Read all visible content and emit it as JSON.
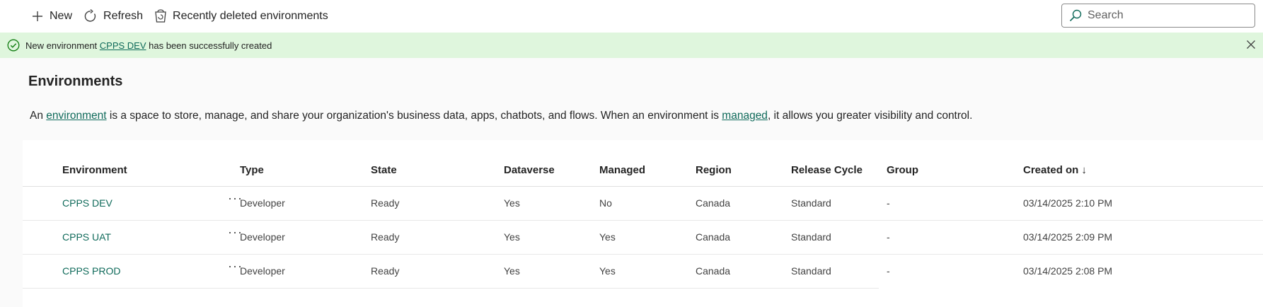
{
  "commandbar": {
    "new_label": "New",
    "refresh_label": "Refresh",
    "recently_deleted_label": "Recently deleted environments",
    "search_placeholder": "Search"
  },
  "banner": {
    "prefix": "New environment ",
    "env_link": "CPPS DEV",
    "suffix": " has been successfully created"
  },
  "page": {
    "title": "Environments",
    "desc_part1": "An ",
    "desc_link1": "environment",
    "desc_part2": " is a space to store, manage, and share your organization's business data, apps, chatbots, and flows. When an environment is ",
    "desc_link2": "managed",
    "desc_part3": ", it allows you greater visibility and control."
  },
  "table": {
    "headers": {
      "environment": "Environment",
      "type": "Type",
      "state": "State",
      "dataverse": "Dataverse",
      "managed": "Managed",
      "region": "Region",
      "release_cycle": "Release Cycle",
      "group": "Group",
      "created_on": "Created on",
      "sort_indicator": "↓"
    },
    "more_glyph": "···",
    "rows": [
      {
        "environment": "CPPS DEV",
        "type": "Developer",
        "state": "Ready",
        "dataverse": "Yes",
        "managed": "No",
        "region": "Canada",
        "release_cycle": "Standard",
        "group": "-",
        "created_on": "03/14/2025 2:10 PM"
      },
      {
        "environment": "CPPS UAT",
        "type": "Developer",
        "state": "Ready",
        "dataverse": "Yes",
        "managed": "Yes",
        "region": "Canada",
        "release_cycle": "Standard",
        "group": "-",
        "created_on": "03/14/2025 2:09 PM"
      },
      {
        "environment": "CPPS PROD",
        "type": "Developer",
        "state": "Ready",
        "dataverse": "Yes",
        "managed": "Yes",
        "region": "Canada",
        "release_cycle": "Standard",
        "group": "-",
        "created_on": "03/14/2025 2:08 PM"
      }
    ]
  },
  "colors": {
    "banner_bg": "#dff6dd",
    "link": "#0f6a5a",
    "success_icon": "#107c10"
  }
}
